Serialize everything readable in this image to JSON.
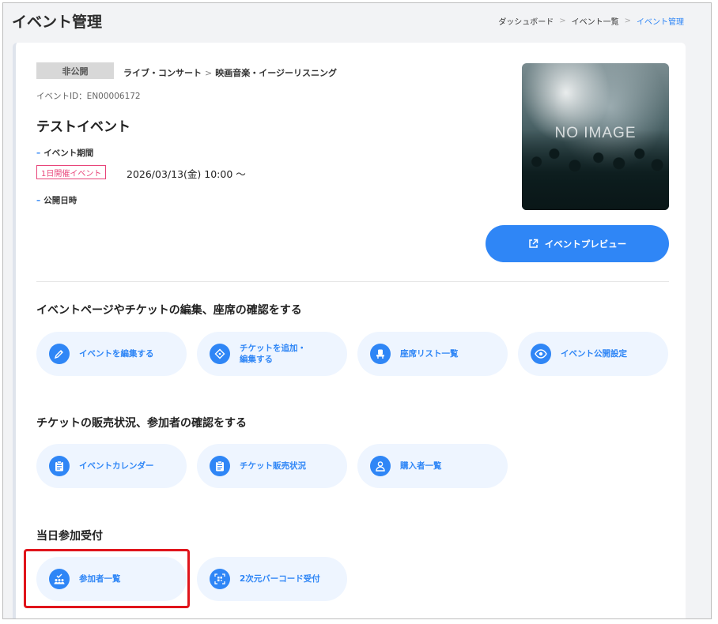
{
  "header": {
    "title": "イベント管理",
    "breadcrumb": [
      "ダッシュボード",
      "イベント一覧",
      "イベント管理"
    ]
  },
  "event": {
    "status": "非公開",
    "category_parent": "ライブ・コンサート",
    "category_child": "映画音楽・イージーリスニング",
    "id_label": "イベントID：EN00006172",
    "name": "テストイベント",
    "period_label": "イベント期間",
    "period_badge": "1日開催イベント",
    "period_value": "2026/03/13(金) 10:00 〜",
    "publish_label": "公開日時",
    "thumbnail_text": "NO IMAGE",
    "preview_button": "イベントプレビュー"
  },
  "sections": [
    {
      "title": "イベントページやチケットの編集、座席の確認をする",
      "actions": [
        {
          "label": "イベントを編集する",
          "icon": "pencil-icon"
        },
        {
          "label": "チケットを追加・\n編集する",
          "icon": "ticket-icon"
        },
        {
          "label": "座席リスト一覧",
          "icon": "seat-icon"
        },
        {
          "label": "イベント公開設定",
          "icon": "eye-icon"
        }
      ]
    },
    {
      "title": "チケットの販売状況、参加者の確認をする",
      "actions": [
        {
          "label": "イベントカレンダー",
          "icon": "clipboard-icon"
        },
        {
          "label": "チケット販売状況",
          "icon": "clipboard-icon"
        },
        {
          "label": "購入者一覧",
          "icon": "user-icon"
        }
      ]
    },
    {
      "title": "当日参加受付",
      "actions": [
        {
          "label": "参加者一覧",
          "icon": "attendees-icon"
        },
        {
          "label": "2次元バーコード受付",
          "icon": "qr-scan-icon"
        }
      ]
    }
  ],
  "colors": {
    "accent": "#2f86f6",
    "badge_pink": "#e8457a",
    "highlight_red": "#e0141b"
  }
}
